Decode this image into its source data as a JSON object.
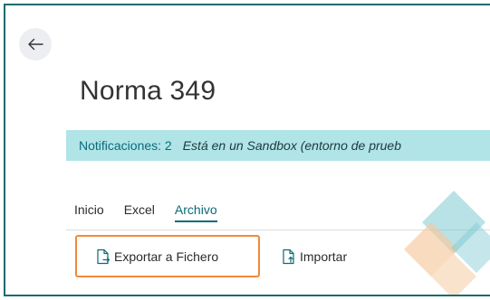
{
  "colors": {
    "frame_border": "#1a6a73",
    "accent": "#0b6a78",
    "notification_bg": "#b0e4e7",
    "highlight_border": "#ef8a3a",
    "decor_teal": "#7fcad3",
    "decor_orange": "#f6c79c"
  },
  "header": {
    "back_icon": "arrow-left-icon",
    "title": "Norma 349"
  },
  "notification": {
    "link_label": "Notificaciones: 2",
    "message": "Está en un Sandbox (entorno de prueb"
  },
  "tabs": [
    {
      "label": "Inicio",
      "active": false
    },
    {
      "label": "Excel",
      "active": false
    },
    {
      "label": "Archivo",
      "active": true
    }
  ],
  "actions": {
    "export": {
      "label": "Exportar a Fichero",
      "icon": "document-export-icon",
      "highlighted": true
    },
    "import": {
      "label": "Importar",
      "icon": "document-import-icon",
      "highlighted": false
    }
  }
}
